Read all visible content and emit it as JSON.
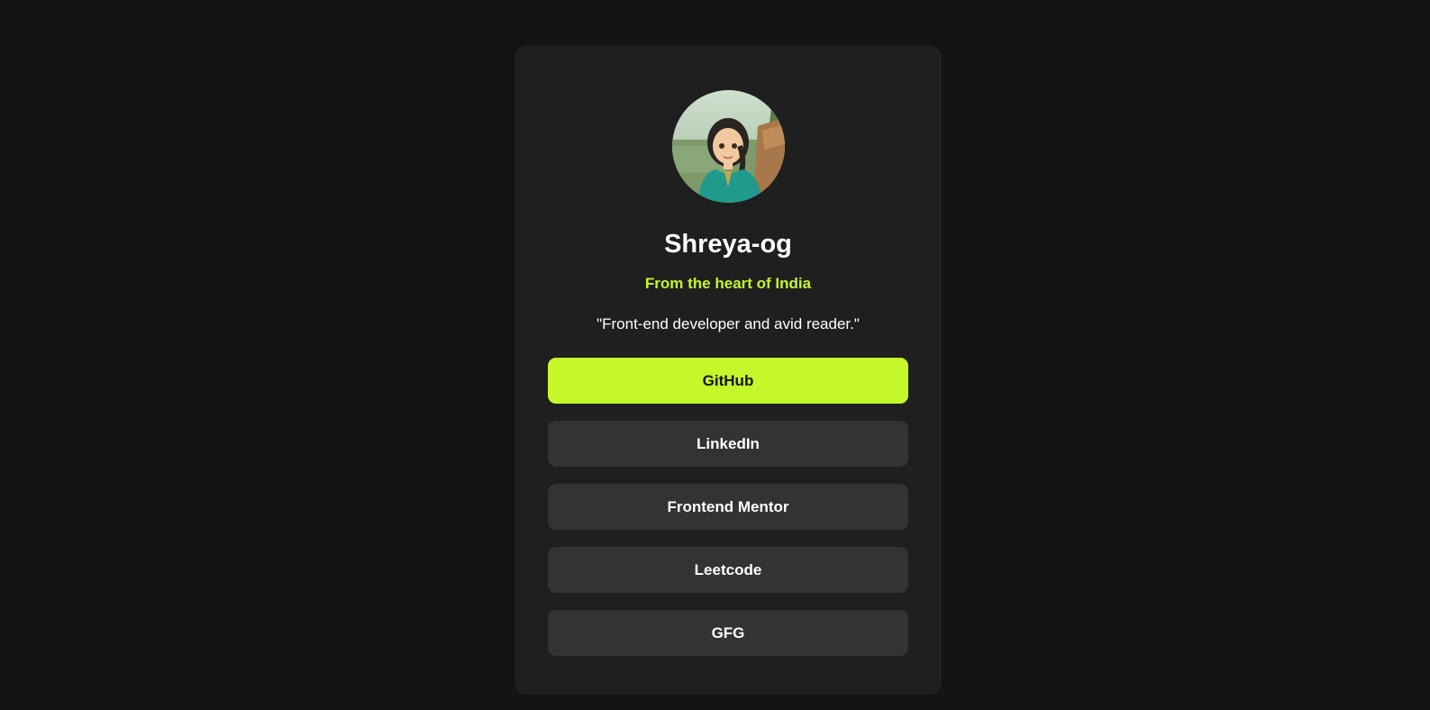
{
  "profile": {
    "name": "Shreya-og",
    "location": "From the heart of India",
    "bio": "\"Front-end developer and avid reader.\"",
    "avatar_icon": "avatar-illustration"
  },
  "links": [
    {
      "label": "GitHub",
      "active": true
    },
    {
      "label": "LinkedIn",
      "active": false
    },
    {
      "label": "Frontend Mentor",
      "active": false
    },
    {
      "label": "Leetcode",
      "active": false
    },
    {
      "label": "GFG",
      "active": false
    }
  ],
  "colors": {
    "page_background": "#141414",
    "card_background": "#1f1f1f",
    "accent": "#c4f82a",
    "button_background": "#333333",
    "text": "#ffffff"
  }
}
